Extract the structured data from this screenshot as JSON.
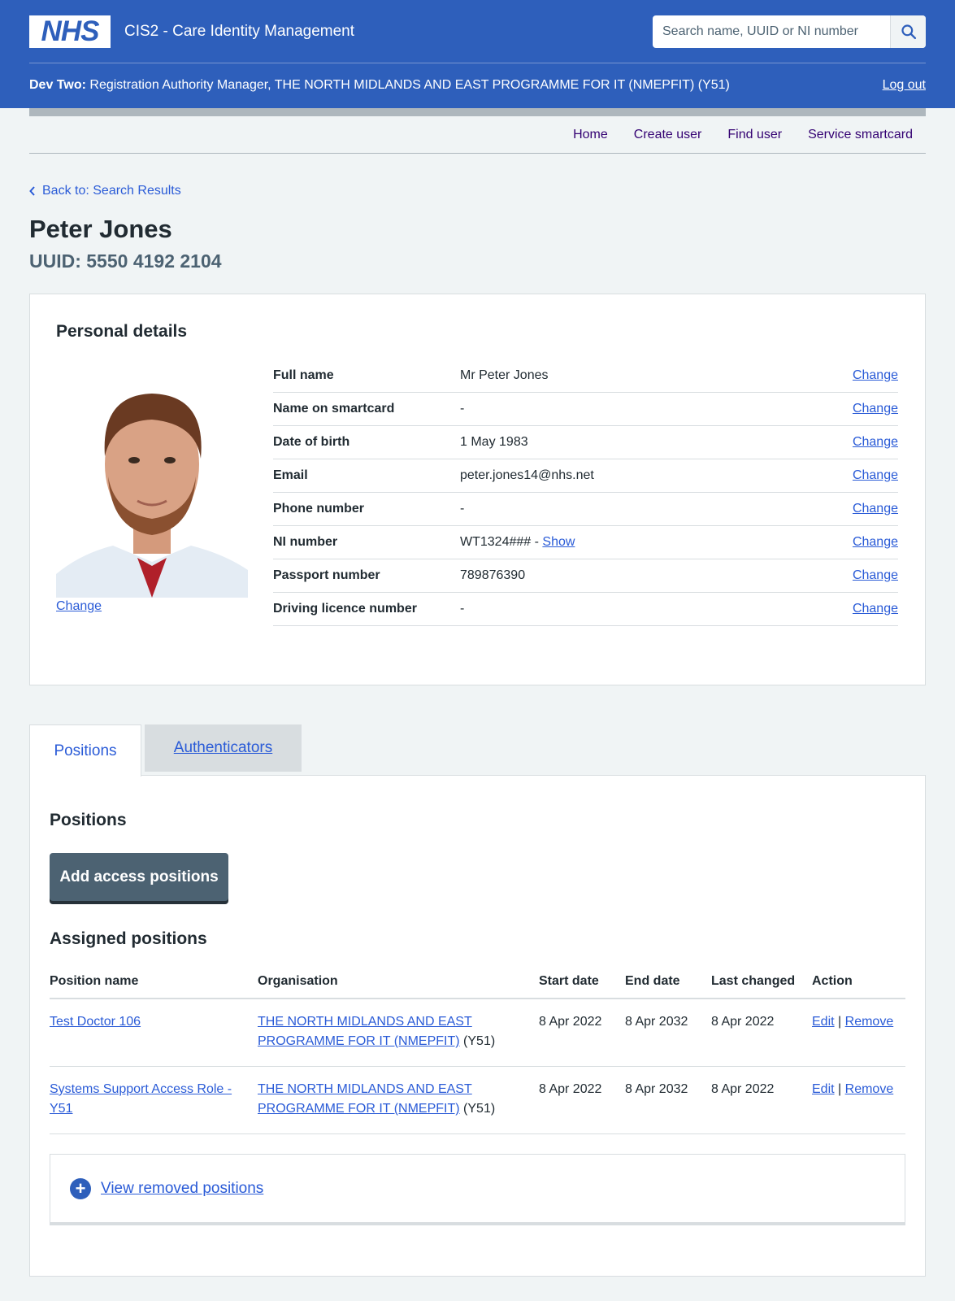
{
  "header": {
    "logo_text": "NHS",
    "service_name": "CIS2 - Care Identity Management",
    "search_placeholder": "Search name, UUID or NI number",
    "user_label": "Dev Two:",
    "user_role": "Registration Authority Manager, THE NORTH MIDLANDS AND EAST PROGRAMME FOR IT (NMEPFIT) (Y51)",
    "logout_label": "Log out"
  },
  "nav": {
    "home": "Home",
    "create_user": "Create user",
    "find_user": "Find user",
    "service_smartcard": "Service smartcard"
  },
  "back_link": "Back to: Search Results",
  "person": {
    "name": "Peter Jones",
    "uuid": "UUID: 5550 4192 2104"
  },
  "personal_details": {
    "heading": "Personal details",
    "photo_change": "Change",
    "change_label": "Change",
    "rows": [
      {
        "key": "Full name",
        "value": "Mr Peter Jones"
      },
      {
        "key": "Name on smartcard",
        "value": "-"
      },
      {
        "key": "Date of birth",
        "value": "1 May 1983"
      },
      {
        "key": "Email",
        "value": "peter.jones14@nhs.net"
      },
      {
        "key": "Phone number",
        "value": "-"
      },
      {
        "key": "NI number",
        "value": "WT1324### - ",
        "link": "Show"
      },
      {
        "key": "Passport number",
        "value": "789876390"
      },
      {
        "key": "Driving licence number",
        "value": "-"
      }
    ]
  },
  "tabs": {
    "positions": "Positions",
    "authenticators": "Authenticators"
  },
  "positions": {
    "heading": "Positions",
    "add_button": "Add access positions",
    "assigned_heading": "Assigned positions",
    "columns": [
      "Position name",
      "Organisation",
      "Start date",
      "End date",
      "Last changed",
      "Action"
    ],
    "rows": [
      {
        "name": "Test Doctor 106",
        "org_link": "THE NORTH MIDLANDS AND EAST PROGRAMME FOR IT (NMEPFIT)",
        "org_code": " (Y51)",
        "start": "8 Apr 2022",
        "end": "8 Apr 2032",
        "changed": "8 Apr 2022",
        "edit": "Edit",
        "sep": "|",
        "remove": "Remove"
      },
      {
        "name": "Systems Support Access Role - Y51",
        "org_link": "THE NORTH MIDLANDS AND EAST PROGRAMME FOR IT (NMEPFIT)",
        "org_code": " (Y51)",
        "start": "8 Apr 2022",
        "end": "8 Apr 2032",
        "changed": "8 Apr 2022",
        "edit": "Edit",
        "sep": "|",
        "remove": "Remove"
      }
    ],
    "view_removed": "View removed positions"
  }
}
